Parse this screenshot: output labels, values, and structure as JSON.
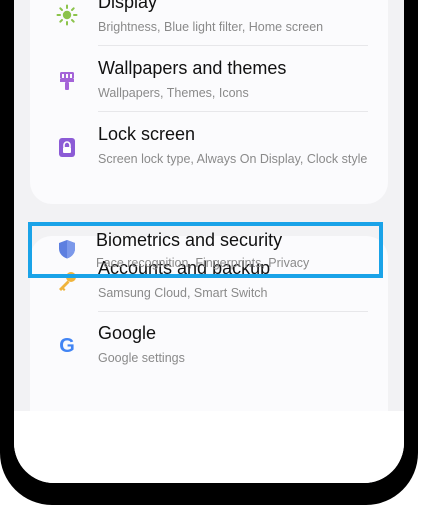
{
  "settings": {
    "items": [
      {
        "title": "Display",
        "subtitle": "Brightness, Blue light filter, Home screen",
        "icon": "sun-icon",
        "color": "#8bc34a"
      },
      {
        "title": "Wallpapers and themes",
        "subtitle": "Wallpapers, Themes, Icons",
        "icon": "brush-icon",
        "color": "#a463d8"
      },
      {
        "title": "Lock screen",
        "subtitle": "Screen lock type, Always On Display, Clock style",
        "icon": "lock-icon",
        "color": "#8c5bd6"
      },
      {
        "title": "Biometrics and security",
        "subtitle": "Face recognition, Fingerprints, Privacy",
        "icon": "shield-icon",
        "color": "#5d7fe0"
      },
      {
        "title": "Accounts and backup",
        "subtitle": "Samsung Cloud, Smart Switch",
        "icon": "key-icon",
        "color": "#f0b43c"
      },
      {
        "title": "Google",
        "subtitle": "Google settings",
        "icon": "google-icon",
        "color": "#4285f4"
      }
    ]
  },
  "google_glyph": "G",
  "highlight": {
    "color": "#1aa3e8"
  }
}
